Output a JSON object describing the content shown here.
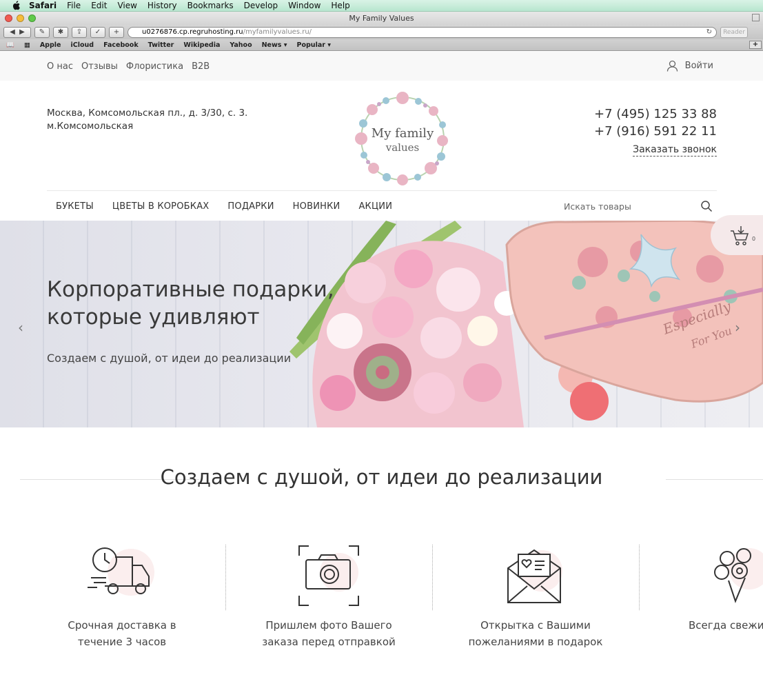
{
  "menubar": {
    "items": [
      "Safari",
      "File",
      "Edit",
      "View",
      "History",
      "Bookmarks",
      "Develop",
      "Window",
      "Help"
    ]
  },
  "window": {
    "title": "My Family Values"
  },
  "toolbar": {
    "url_main": "u0276876.cp.regruhosting.ru",
    "url_path": "/myfamilyvalues.ru/",
    "reader_label": "Reader",
    "add_label": "+"
  },
  "bookmarks": {
    "items": [
      "Apple",
      "iCloud",
      "Facebook",
      "Twitter",
      "Wikipedia",
      "Yahoo",
      "News ▾",
      "Popular ▾"
    ]
  },
  "topnav": {
    "links": [
      "О нас",
      "Отзывы",
      "Флористика",
      "B2B"
    ],
    "login": "Войти"
  },
  "header": {
    "address_line1": "Москва, Комсомольская пл., д. 3/30, с. 3.",
    "address_line2": "м.Комсомольская",
    "logo_line1": "My family",
    "logo_line2": "values",
    "phone1": "+7 (495) 125 33 88",
    "phone2": "+7 (916) 591 22 11",
    "callback": "Заказать звонок"
  },
  "mainnav": {
    "items": [
      "БУКЕТЫ",
      "ЦВЕТЫ В КОРОБКАХ",
      "ПОДАРКИ",
      "НОВИНКИ",
      "АКЦИИ"
    ],
    "search_placeholder": "Искать товары"
  },
  "hero": {
    "title_line1": "Корпоративные подарки,",
    "title_line2": "которые удивляют",
    "subtitle": "Создаем с душой, от идеи до реализации",
    "box_text1": "Especially",
    "box_text2": "For You"
  },
  "cart": {
    "count": "0"
  },
  "section": {
    "title": "Создаем с душой, от идеи до реализации"
  },
  "features": [
    {
      "line1": "Срочная доставка в",
      "line2": "течение 3 часов"
    },
    {
      "line1": "Пришлем фото Вашего",
      "line2": "заказа перед отправкой"
    },
    {
      "line1": "Открытка с Вашими",
      "line2": "пожеланиями в подарок"
    },
    {
      "line1": "Всегда свежие",
      "line2": ""
    }
  ],
  "colors": {
    "accent_pink": "#f5e9ea",
    "text": "#333333"
  }
}
